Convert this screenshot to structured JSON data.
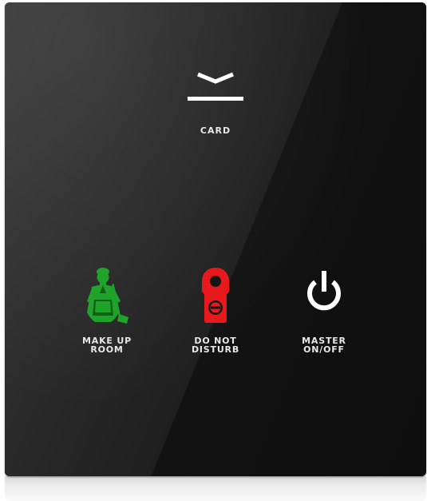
{
  "panel": {
    "card": {
      "label": "CARD",
      "icon": "card-slot-icon"
    },
    "buttons": [
      {
        "line1": "MAKE UP",
        "line2": "ROOM",
        "icon": "maid-icon",
        "color": "#1fa32a"
      },
      {
        "line1": "DO NOT",
        "line2": "DISTURB",
        "icon": "door-hanger-icon",
        "color": "#e8191c"
      },
      {
        "line1": "MASTER",
        "line2": "ON/OFF",
        "icon": "power-icon",
        "color": "#ffffff"
      }
    ]
  }
}
